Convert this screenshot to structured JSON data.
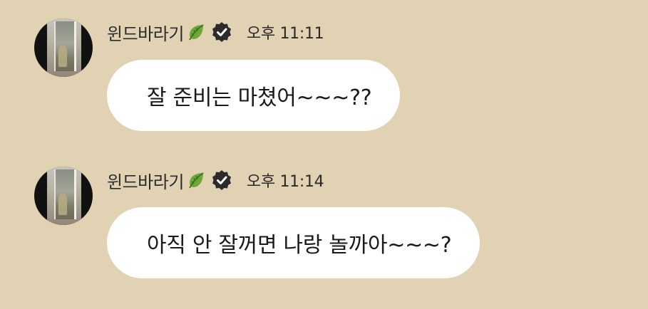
{
  "theme": {
    "background": "#e1d2b4",
    "bubble": "#ffffff",
    "verified_badge": "#2b2b2b",
    "leaf": "#6fa83a"
  },
  "messages": [
    {
      "sender": "윈드바라기",
      "icons": [
        "leaf-icon",
        "verified-icon"
      ],
      "time": "오후 11:11",
      "text": "잘 준비는 마쳤어~~~??"
    },
    {
      "sender": "윈드바라기",
      "icons": [
        "leaf-icon",
        "verified-icon"
      ],
      "time": "오후 11:14",
      "text": "아직 안 잘꺼면 나랑 놀까아~~~?"
    }
  ]
}
